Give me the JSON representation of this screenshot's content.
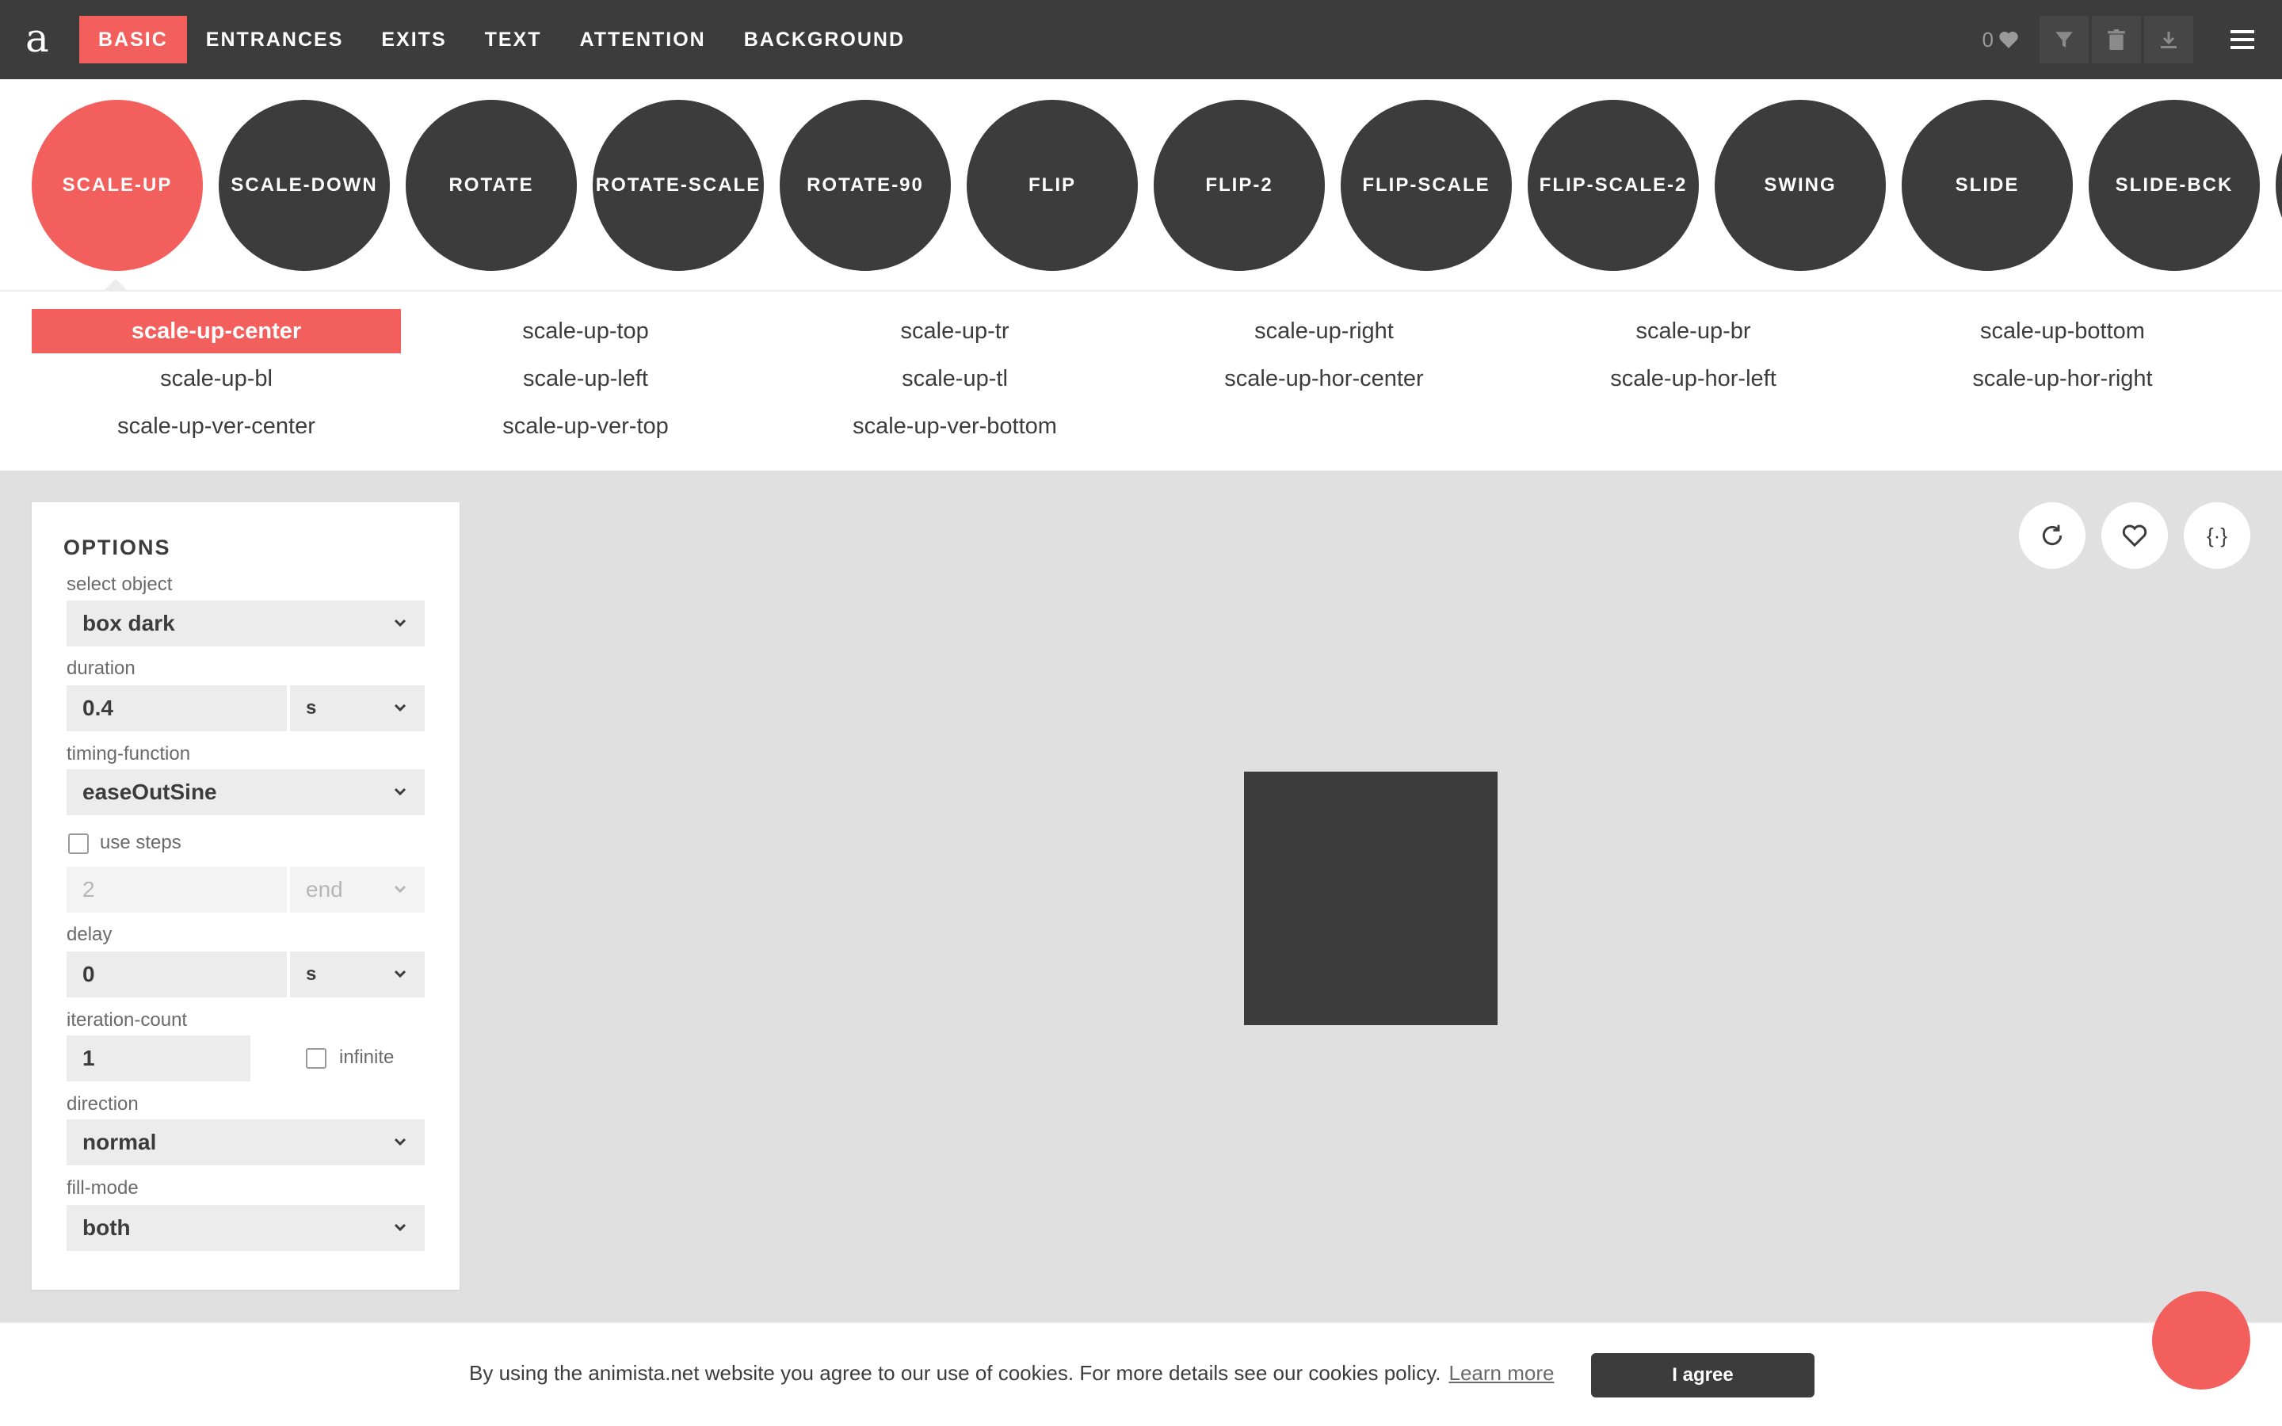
{
  "nav": {
    "logo": "a",
    "tabs": [
      "BASIC",
      "ENTRANCES",
      "EXITS",
      "TEXT",
      "ATTENTION",
      "BACKGROUND"
    ],
    "active_tab": "BASIC",
    "fav_count": "0"
  },
  "animations": [
    "SCALE-UP",
    "SCALE-DOWN",
    "ROTATE",
    "ROTATE-SCALE",
    "ROTATE-90",
    "FLIP",
    "FLIP-2",
    "FLIP-SCALE",
    "FLIP-SCALE-2",
    "SWING",
    "SLIDE",
    "SLIDE-BCK"
  ],
  "active_animation": "SCALE-UP",
  "variants": [
    "scale-up-center",
    "scale-up-top",
    "scale-up-tr",
    "scale-up-right",
    "scale-up-br",
    "scale-up-bottom",
    "scale-up-bl",
    "scale-up-left",
    "scale-up-tl",
    "scale-up-hor-center",
    "scale-up-hor-left",
    "scale-up-hor-right",
    "scale-up-ver-center",
    "scale-up-ver-top",
    "scale-up-ver-bottom"
  ],
  "active_variant": "scale-up-center",
  "options": {
    "title": "OPTIONS",
    "select_object_label": "select object",
    "select_object_value": "box dark",
    "duration_label": "duration",
    "duration_value": "0.4",
    "duration_unit": "s",
    "timing_label": "timing-function",
    "timing_value": "easeOutSine",
    "use_steps_label": "use steps",
    "use_steps_checked": false,
    "steps_value": "2",
    "steps_mode": "end",
    "delay_label": "delay",
    "delay_value": "0",
    "delay_unit": "s",
    "iteration_label": "iteration-count",
    "iteration_value": "1",
    "infinite_label": "infinite",
    "infinite_checked": false,
    "direction_label": "direction",
    "direction_value": "normal",
    "fill_label": "fill-mode",
    "fill_value": "both"
  },
  "stage": {
    "code_button_label": "{·}"
  },
  "cookie": {
    "text": "By using the animista.net website you agree to our use of cookies. For more details see our cookies policy.",
    "link": "Learn more",
    "button": "I agree"
  },
  "colors": {
    "accent": "#f25f5c",
    "dark": "#3c3c3c",
    "stage_bg": "#e0e0e0"
  }
}
